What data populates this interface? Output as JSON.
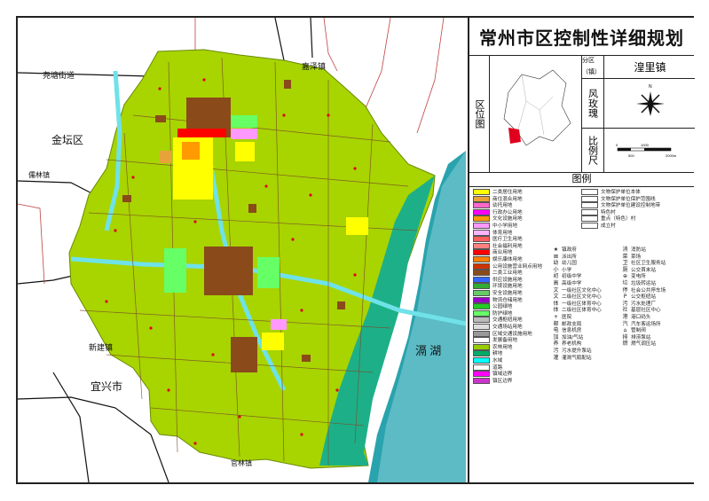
{
  "title": "常州市区控制性详细规划",
  "location_label": "区位图",
  "info": {
    "district_key": "分区（镇）",
    "district_value": "湟里镇",
    "rose_key": "风玫瑰",
    "rose_north": "N",
    "scale_key": "比例尺",
    "scale_ticks": [
      "0",
      "500",
      "1000",
      "2000m"
    ]
  },
  "legend_title": "图例",
  "map_labels": {
    "yaotang": "尧塘街道",
    "jiaze": "嘉泽镇",
    "jintan": "金坛区",
    "rulin": "儒林镇",
    "xinjian": "新建镇",
    "yixing": "宜兴市",
    "guanlin": "官林镇",
    "gehu": "滆  湖",
    "stamp": "图例 比例尺"
  },
  "legend_landuse": [
    {
      "label": "二类居住用地",
      "color": "#ffff00"
    },
    {
      "label": "商住混合用地",
      "color": "#e8a23a"
    },
    {
      "label": "幼托用地",
      "color": "#ff66cc"
    },
    {
      "label": "行政办公用地",
      "color": "#ff00ff"
    },
    {
      "label": "文化设施用地",
      "color": "#ff9a00"
    },
    {
      "label": "中小学用地",
      "color": "#ff99ff"
    },
    {
      "label": "体育用地",
      "color": "#ffb3ff"
    },
    {
      "label": "医疗卫生用地",
      "color": "#ff5e5e"
    },
    {
      "label": "社会福利用地",
      "color": "#ff8080"
    },
    {
      "label": "商业用地",
      "color": "#ff0000"
    },
    {
      "label": "娱乐康体用地",
      "color": "#ff7f00"
    },
    {
      "label": "公用设施营业网点用地",
      "color": "#cc3300"
    },
    {
      "label": "二类工业用地",
      "color": "#8a4a1a"
    },
    {
      "label": "供应设施用地",
      "color": "#3366ff"
    },
    {
      "label": "环境设施用地",
      "color": "#33aa33"
    },
    {
      "label": "安全设施用地",
      "color": "#66cc66"
    },
    {
      "label": "物流仓储用地",
      "color": "#9900cc"
    },
    {
      "label": "公园绿地",
      "color": "#22cc22"
    },
    {
      "label": "防护绿地",
      "color": "#66ff66"
    },
    {
      "label": "交通枢纽用地",
      "color": "#bbbbbb"
    },
    {
      "label": "交通场站用地",
      "color": "#dddddd"
    },
    {
      "label": "区域交通设施用地",
      "color": "#999999"
    },
    {
      "label": "发展备用地",
      "color": "#ffffff"
    },
    {
      "label": "农林用地",
      "color": "#99cc00"
    },
    {
      "label": "耕地",
      "color": "#00aa66"
    },
    {
      "label": "水域",
      "color": "#00ffff"
    },
    {
      "label": "道路",
      "color": "#ffffff"
    },
    {
      "label": "镇域边界",
      "color": "#ff00ff"
    },
    {
      "label": "镇区边界",
      "color": "#cc33cc"
    }
  ],
  "legend_heritage": [
    {
      "label": "文物保护单位本体",
      "color": "#ffffff"
    },
    {
      "label": "文物保护单位保护范围线",
      "color": "#ffffff"
    },
    {
      "label": "文物保护单位建设控制地带",
      "color": "#ffffff"
    },
    {
      "label": "特色村",
      "color": "#ffffff"
    },
    {
      "label": "重点（特色）村",
      "color": "#ffffff"
    },
    {
      "label": "成立村",
      "color": "#ffffff"
    }
  ],
  "legend_points_a": [
    {
      "icon": "★",
      "label": "镇政府"
    },
    {
      "icon": "⊠",
      "label": "派出所"
    },
    {
      "icon": "幼",
      "label": "幼儿园"
    },
    {
      "icon": "小",
      "label": "小学"
    },
    {
      "icon": "初",
      "label": "初级中学"
    },
    {
      "icon": "高",
      "label": "高级中学"
    },
    {
      "icon": "文",
      "label": "一级社区文化中心"
    },
    {
      "icon": "文",
      "label": "二级社区文化中心"
    },
    {
      "icon": "体",
      "label": "一级社区体育中心"
    },
    {
      "icon": "体",
      "label": "二级社区体育中心"
    },
    {
      "icon": "+",
      "label": "医院"
    },
    {
      "icon": "邮",
      "label": "邮政支局"
    },
    {
      "icon": "电",
      "label": "信息机房"
    },
    {
      "icon": "加",
      "label": "加油/气站"
    },
    {
      "icon": "养",
      "label": "养老机构"
    },
    {
      "icon": "污",
      "label": "污水提升泵站"
    },
    {
      "icon": "灌",
      "label": "灌溉气瓶配站"
    }
  ],
  "legend_points_b": [
    {
      "icon": "消",
      "label": "消防站"
    },
    {
      "icon": "菜",
      "label": "菜场"
    },
    {
      "icon": "卫",
      "label": "社区卫生服务站"
    },
    {
      "icon": "厕",
      "label": "公交首末站"
    },
    {
      "icon": "⊕",
      "label": "变电所"
    },
    {
      "icon": "垃",
      "label": "垃圾转运站"
    },
    {
      "icon": "停",
      "label": "社会公共停车场"
    },
    {
      "icon": "P",
      "label": "公交枢纽站"
    },
    {
      "icon": "污",
      "label": "污水处理厂"
    },
    {
      "icon": "社",
      "label": "基层社区中心"
    },
    {
      "icon": "港",
      "label": "港口码头"
    },
    {
      "icon": "汽",
      "label": "汽车客运场所"
    },
    {
      "icon": "⌂",
      "label": "管制阀"
    },
    {
      "icon": "排",
      "label": "排涝泵站"
    },
    {
      "icon": "燃",
      "label": "燃气调压站"
    }
  ]
}
